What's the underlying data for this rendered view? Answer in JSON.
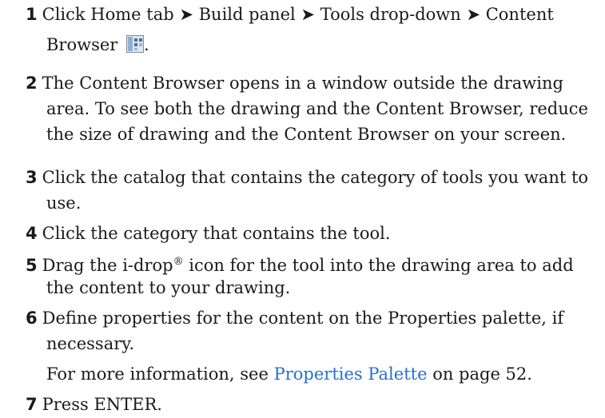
{
  "steps": [
    {
      "number": "1",
      "path": "Click Home tab ➤ Build panel ➤ Tools drop-down ➤ Content",
      "line2": "Browser",
      "icon": "content-browser-icon",
      "trail": "."
    },
    {
      "number": "2",
      "line1": "The Content Browser opens in a window outside the drawing",
      "line2": "area. To see both the drawing and the Content Browser, reduce",
      "line3": "the size of drawing and the Content Browser on your screen."
    },
    {
      "number": "3",
      "line1": "Click the catalog that contains the category of tools you want to",
      "line2": "use."
    },
    {
      "number": "4",
      "line1": "Click the category that contains the tool."
    },
    {
      "number": "5",
      "line1_pre": "Drag the i-drop",
      "line1_sup": "®",
      "line1_post": " icon for the tool into the drawing area to add",
      "line2": "the content to your drawing."
    },
    {
      "number": "6",
      "line1": "Define properties for the content on the Properties palette, if",
      "line2": "necessary."
    },
    {
      "number": "7",
      "line1": "Press ENTER."
    }
  ],
  "more_info": {
    "prefix": "For more information, see ",
    "link": "Properties Palette",
    "suffix": " on page 52."
  },
  "colors": {
    "link": "#2b6fc5",
    "text": "#1a1a1a"
  }
}
